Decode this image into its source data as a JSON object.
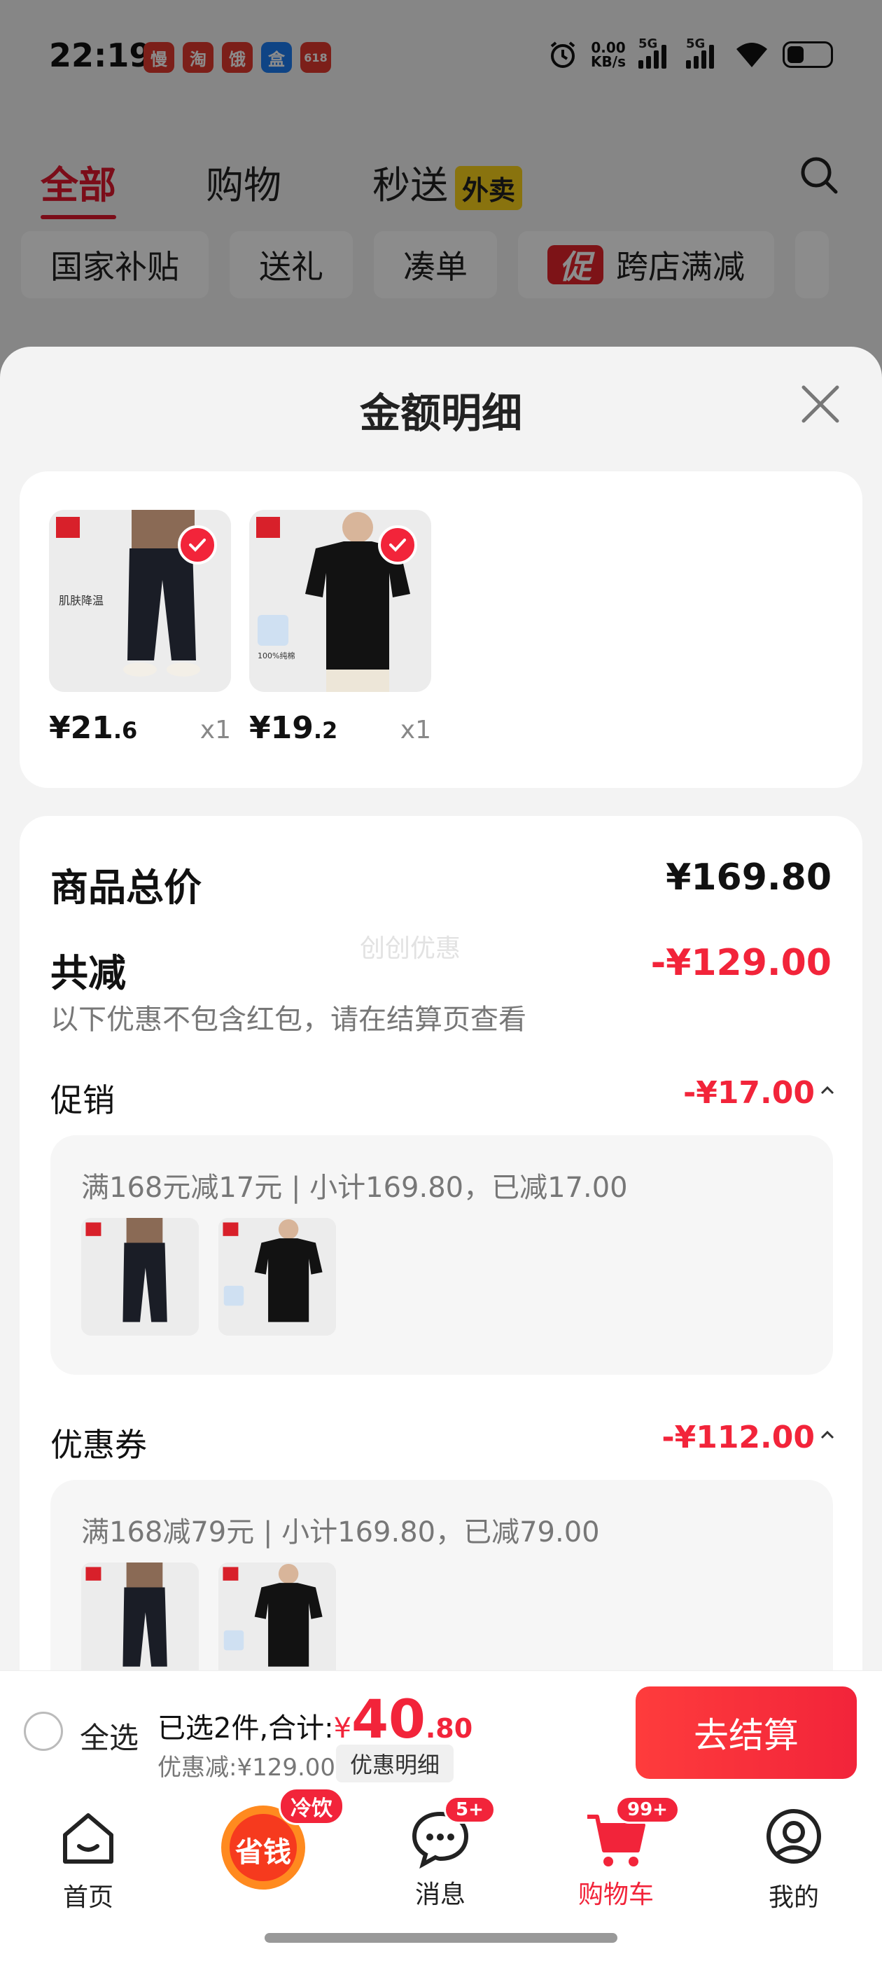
{
  "status_bar": {
    "time": "22:19",
    "apps": [
      "慢",
      "淘",
      "饿",
      "盒",
      "618"
    ],
    "net_speed_value": "0.00",
    "net_speed_unit": "KB/s",
    "signal_1": "5G",
    "signal_2": "5G"
  },
  "background": {
    "tabs": [
      {
        "label": "全部",
        "active": true
      },
      {
        "label": "购物",
        "active": false
      },
      {
        "label": "秒送",
        "active": false
      }
    ],
    "waimai_badge": "外卖",
    "chips": [
      "国家补贴",
      "送礼",
      "凑单",
      "跨店满减"
    ],
    "chip_promo_icon": "促"
  },
  "sheet": {
    "title": "金额明细",
    "items": [
      {
        "price_int": "¥21",
        "price_dec": ".6",
        "qty": "x1",
        "thumb_caption": "肌肤降温"
      },
      {
        "price_int": "¥19",
        "price_dec": ".2",
        "qty": "x1",
        "thumb_caption": "100%纯棉"
      }
    ],
    "summary": {
      "total_label": "商品总价",
      "total_value": "¥169.80",
      "reduce_label": "共减",
      "reduce_value": "-¥129.00",
      "reduce_note": "以下优惠不包含红包，请在结算页查看",
      "watermark": "创创优惠"
    },
    "promotion": {
      "label": "促销",
      "value": "-¥17.00",
      "rule": "满168元减17元 | 小计169.80，已减17.00"
    },
    "coupon": {
      "label": "优惠券",
      "value": "-¥112.00",
      "rule": "满168减79元 | 小计169.80，已减79.00"
    }
  },
  "action_bar": {
    "select_all": "全选",
    "selected_prefix": "已选2件,合计:",
    "currency": "¥",
    "total_int": "40",
    "total_dec": ".80",
    "discount": "优惠减:¥129.00",
    "detail_button": "优惠明细",
    "checkout_button": "去结算"
  },
  "bottom_nav": [
    {
      "label": "首页",
      "icon": "home-icon",
      "badge": ""
    },
    {
      "label": "",
      "icon": "save-money-icon",
      "badge": "冷饮",
      "center_text": "省钱"
    },
    {
      "label": "消息",
      "icon": "message-icon",
      "badge": "5+"
    },
    {
      "label": "购物车",
      "icon": "cart-icon",
      "badge": "99+",
      "active": true
    },
    {
      "label": "我的",
      "icon": "profile-icon",
      "badge": ""
    }
  ],
  "colors": {
    "accent": "#f2243a",
    "active_tab": "#e0182e",
    "waimai": "#f9d11a"
  }
}
